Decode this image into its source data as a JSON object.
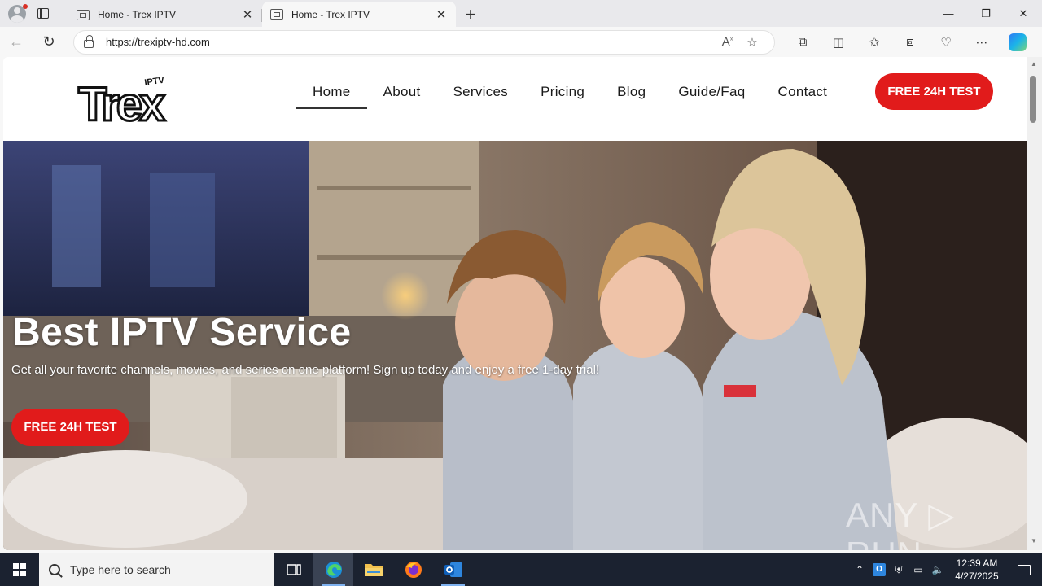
{
  "browser": {
    "tabs": [
      {
        "title": "Home - Trex IPTV",
        "active": false
      },
      {
        "title": "Home - Trex IPTV",
        "active": true
      }
    ],
    "url": "https://trexiptv-hd.com",
    "icons": {
      "profile": "profile-icon",
      "tab_actions": "tab-actions-icon",
      "back": "back-arrow-icon",
      "refresh": "refresh-icon",
      "read_aloud": "read-aloud-icon",
      "favorite": "star-icon",
      "extensions": "puzzle-icon",
      "split": "split-screen-icon",
      "favorites": "favorites-icon",
      "collections": "collections-icon",
      "performance": "heart-pulse-icon",
      "more": "more-icon",
      "copilot": "copilot-icon"
    }
  },
  "site": {
    "logo_text": "Trex",
    "logo_small": "IPTV",
    "nav": [
      "Home",
      "About",
      "Services",
      "Pricing",
      "Blog",
      "Guide/Faq",
      "Contact"
    ],
    "header_cta": "FREE 24H TEST",
    "accent_color": "#e11b1b"
  },
  "hero": {
    "title": "Best IPTV Service",
    "subtitle": "Get all your favorite channels, movies, and series on one platform! Sign up today and enjoy a free 1-day trial!",
    "cta": "FREE 24H TEST",
    "watermark": "ANY ▷ RUN"
  },
  "taskbar": {
    "search_placeholder": "Type here to search",
    "time": "12:39 AM",
    "date": "4/27/2025",
    "apps": [
      "task-view-icon",
      "edge-icon",
      "file-explorer-icon",
      "firefox-icon",
      "outlook-icon"
    ]
  }
}
